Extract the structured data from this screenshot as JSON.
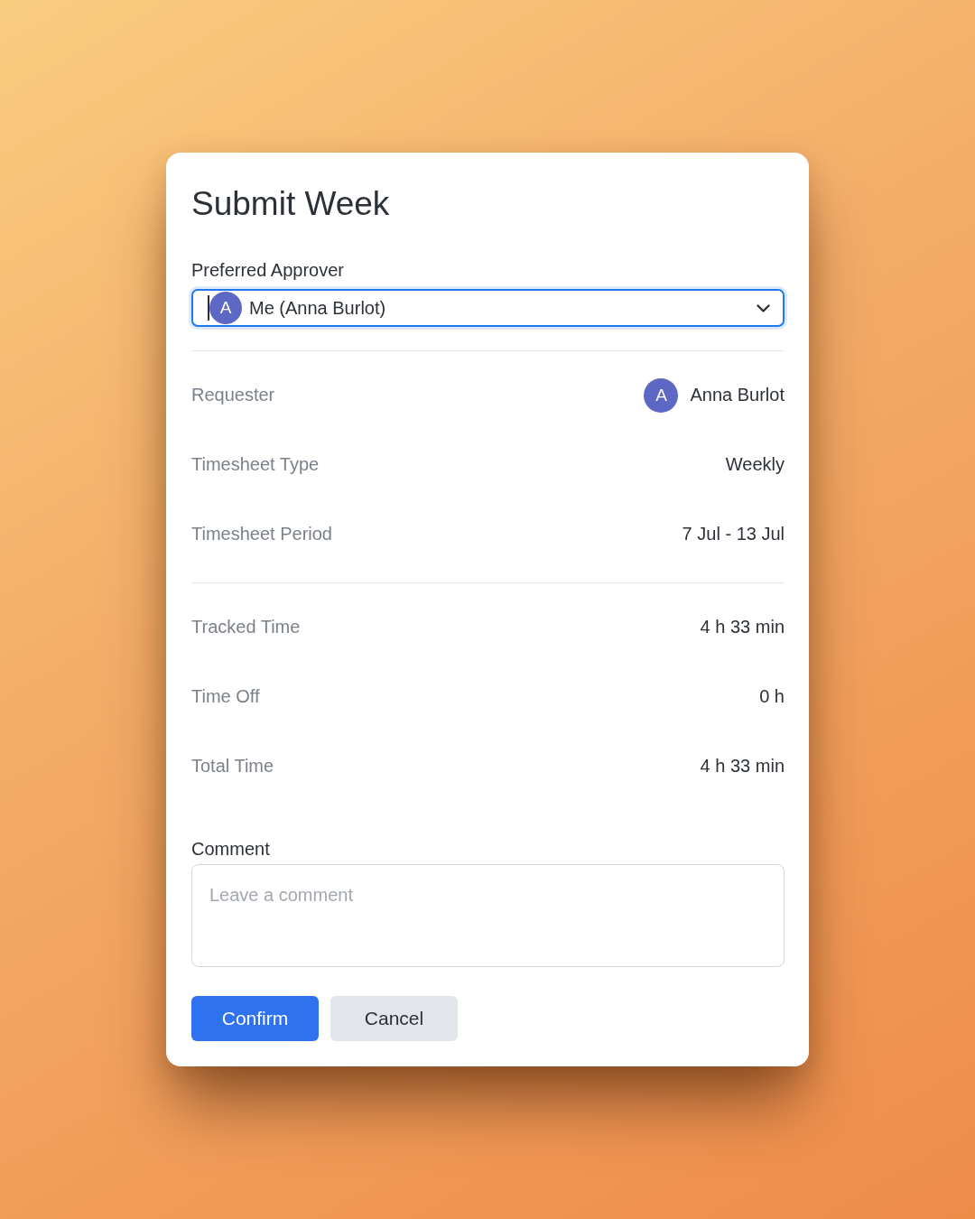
{
  "dialog": {
    "title": "Submit Week",
    "approver": {
      "label": "Preferred Approver",
      "value": "Me (Anna Burlot)",
      "avatar": "A",
      "focused": true
    },
    "sections": [
      {
        "rows": [
          {
            "label": "Requester",
            "value": "Anna Burlot",
            "avatar": "A"
          },
          {
            "label": "Timesheet Type",
            "value": "Weekly"
          },
          {
            "label": "Timesheet Period",
            "value": "7 Jul - 13 Jul"
          }
        ]
      },
      {
        "rows": [
          {
            "label": "Tracked Time",
            "value": "4 h 33 min"
          },
          {
            "label": "Time Off",
            "value": "0 h"
          },
          {
            "label": "Total Time",
            "value": "4 h 33 min"
          }
        ]
      }
    ],
    "comment": {
      "label": "Comment",
      "placeholder": "Leave a comment"
    },
    "buttons": [
      {
        "label": "Confirm",
        "kind": "primary"
      },
      {
        "label": "Cancel",
        "kind": "secondary"
      }
    ]
  }
}
